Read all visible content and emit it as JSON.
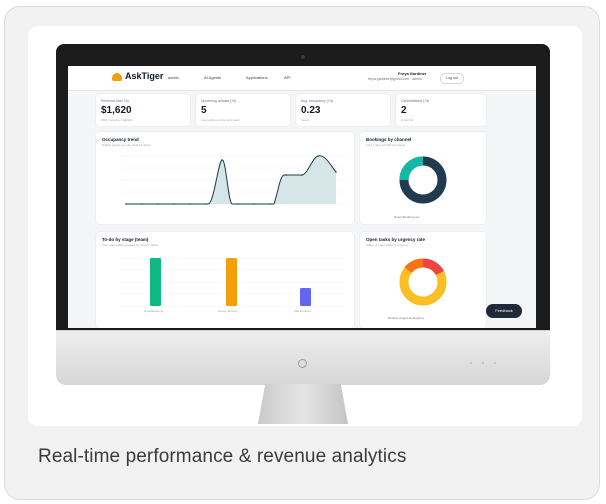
{
  "caption": "Real-time performance & revenue analytics",
  "app": {
    "logo": "AskTiger",
    "nav": [
      {
        "label": "admin",
        "icon": "user-icon"
      },
      {
        "label": "AI Agents",
        "icon": "robot-icon"
      },
      {
        "label": "Applications",
        "icon": "grid-icon"
      },
      {
        "label": "API",
        "icon": "code-icon"
      }
    ],
    "user": {
      "name": "Freya Gardiner",
      "email": "freya.gardiner@gmail.com · admin"
    },
    "logout": "Log out"
  },
  "kpis": [
    {
      "label": "Revenue (last 7d)",
      "value": "$1,620",
      "sub": "ADR / revenue highlight"
    },
    {
      "label": "Upcoming arrivals (7d)",
      "value": "5",
      "sub": "reservations in the next week"
    },
    {
      "label": "Avg. occupancy (7d)",
      "value": "0.23",
      "sub": "rooms"
    },
    {
      "label": "Cancellations (7d)",
      "value": "2",
      "sub": "in last 7d"
    }
  ],
  "occupancy": {
    "title": "Occupancy trend",
    "subtitle": "Nightly guests per day (last 14 days)"
  },
  "channel": {
    "title": "Bookings by channel",
    "subtitle": "Last 7 days (confirmed stays)",
    "legend": "Direct  Booking.com"
  },
  "tasks": {
    "title": "To-do by stage (team)",
    "subtitle": "Your open tasks grouped by current status",
    "categories": [
      "Housekeeping",
      "Guest request",
      "Maintenance"
    ]
  },
  "urgency": {
    "title": "Open tasks by urgency rate",
    "subtitle": "Share of open tasks by urgency",
    "legend": "Routine  Urgent  Emergency"
  },
  "feedback": "Feedback",
  "colors": {
    "teal": "#14b8a6",
    "navy": "#1f3b4d",
    "green": "#10b981",
    "orange": "#f59e0b",
    "blue": "#6366f1",
    "red": "#ef4444",
    "yellow": "#fbbf24"
  }
}
